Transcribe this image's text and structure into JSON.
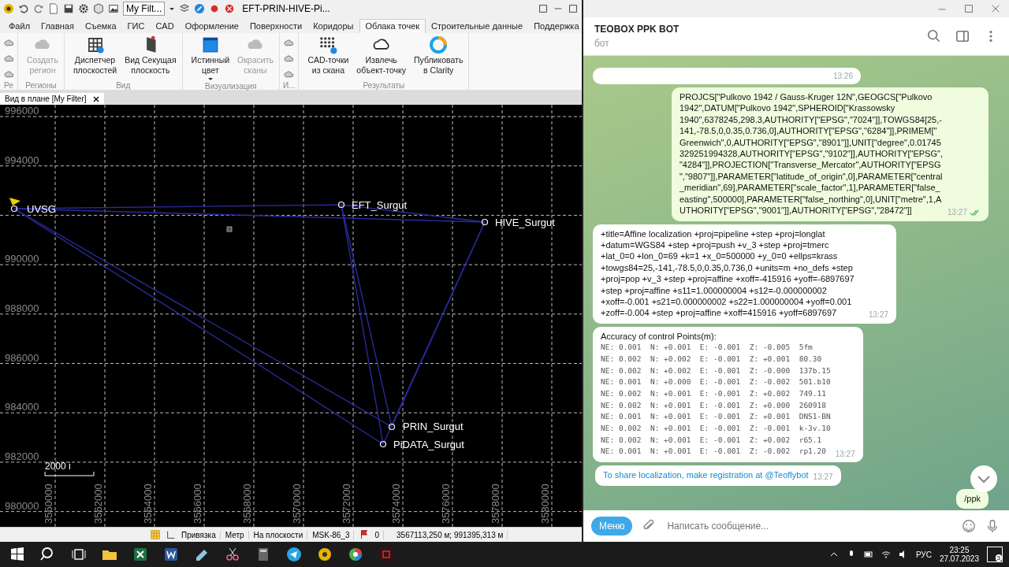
{
  "cad": {
    "filter": "My Filt...",
    "title": "EFT-PRIN-HIVE-Pi...",
    "ribbon_tabs": [
      {
        "label": "Файл",
        "selected": false
      },
      {
        "label": "Главная",
        "selected": false
      },
      {
        "label": "Съемка",
        "selected": false
      },
      {
        "label": "ГИС",
        "selected": false
      },
      {
        "label": "CAD",
        "selected": false
      },
      {
        "label": "Оформление",
        "selected": false
      },
      {
        "label": "Поверхности",
        "selected": false
      },
      {
        "label": "Коридоры",
        "selected": false
      },
      {
        "label": "Облака точек",
        "selected": true
      },
      {
        "label": "Строительные данные",
        "selected": false
      },
      {
        "label": "Поддержка",
        "selected": false
      }
    ],
    "ribbon_groups": [
      {
        "label": "Ре"
      },
      {
        "label": "Регионы",
        "buttons": [
          {
            "label": "Создать\nрегион",
            "disabled": true
          }
        ]
      },
      {
        "label": "Вид",
        "buttons": [
          {
            "label": "Диспетчер\nплоскостей",
            "disabled": false
          },
          {
            "label": "Вид Секущая\nплоскость",
            "disabled": false
          }
        ]
      },
      {
        "label": "Визуализация",
        "buttons": [
          {
            "label": "Истинный\nцвет",
            "disabled": false,
            "dropdown": true
          },
          {
            "label": "Окрасить\nсканы",
            "disabled": true
          }
        ]
      },
      {
        "label": "И..."
      },
      {
        "label": "Результаты",
        "buttons": [
          {
            "label": "CAD-точки\nиз скана",
            "disabled": false
          },
          {
            "label": "Извлечь\nобъект-точку",
            "disabled": false
          },
          {
            "label": "Публиковать\nв Clarity",
            "disabled": false
          }
        ]
      }
    ],
    "doc_tab": "Вид в плане [My Filter]",
    "plan": {
      "y_labels": [
        "996000",
        "994000",
        "990000",
        "988000",
        "986000",
        "984000",
        "982000",
        "980000"
      ],
      "x_labels": [
        "3560000",
        "3562000",
        "3564000",
        "3566000",
        "3568000",
        "3570000",
        "3572000",
        "3574000",
        "3576000",
        "3578000",
        "3580000"
      ],
      "points": [
        {
          "name": "UVSG"
        },
        {
          "name": "EFT_Surgut"
        },
        {
          "name": "HIVE_Surgut"
        },
        {
          "name": "PRIN_Surgut"
        },
        {
          "name": "PiDATA_Surgut"
        }
      ],
      "scale_label": "2000 i"
    },
    "status_bar": {
      "snap": "Привязка",
      "unit": "Метр",
      "plane": "На плоскости",
      "crs": "MSK-86_3",
      "count": "0",
      "coords": "3567113,250 м; 991395,313 м"
    }
  },
  "telegram": {
    "title": "TEOBOX PPK BOT",
    "subtitle": "бот",
    "messages": [
      {
        "kind": "partial",
        "outgoing": false,
        "time": "13:26"
      },
      {
        "kind": "text",
        "outgoing": true,
        "read": true,
        "time": "13:27",
        "text": "PROJCS[\"Pulkovo 1942 / Gauss-Kruger 12N\",GEOGCS[\"Pulkovo 1942\",DATUM[\"Pulkovo 1942\",SPHEROID[\"Krassowsky 1940\",6378245,298.3,AUTHORITY[\"EPSG\",\"7024\"]],TOWGS84[25,-141,-78.5,0,0.35,0.736,0],AUTHORITY[\"EPSG\",\"6284\"]],PRIMEM[\"Greenwich\",0,AUTHORITY[\"EPSG\",\"8901\"]],UNIT[\"degree\",0.01745329251994328,AUTHORITY[\"EPSG\",\"9102\"]],AUTHORITY[\"EPSG\",\"4284\"]],PROJECTION[\"Transverse_Mercator\",AUTHORITY[\"EPSG\",\"9807\"]],PARAMETER[\"latitude_of_origin\",0],PARAMETER[\"central_meridian\",69],PARAMETER[\"scale_factor\",1],PARAMETER[\"false_easting\",500000],PARAMETER[\"false_northing\",0],UNIT[\"metre\",1,AUTHORITY[\"EPSG\",\"9001\"]],AUTHORITY[\"EPSG\",\"28472\"]]"
      },
      {
        "kind": "text",
        "outgoing": false,
        "time": "13:27",
        "text": "+title=Affine localization +proj=pipeline +step +proj=longlat +datum=WGS84 +step +proj=push +v_3 +step +proj=tmerc +lat_0=0 +lon_0=69 +k=1 +x_0=500000 +y_0=0 +ellps=krass +towgs84=25,-141,-78.5,0,0.35,0.736,0 +units=m +no_defs +step +proj=pop +v_3 +step +proj=affine +xoff=-415916 +yoff=-6897697 +step +proj=affine +s11=1.000000004 +s12=-0.000000002 +xoff=-0.001 +s21=0.000000002 +s22=1.000000004 +yoff=0.001 +zoff=-0.004 +step +proj=affine +xoff=415916 +yoff=6897697"
      },
      {
        "kind": "table",
        "outgoing": false,
        "time": "13:27",
        "title": "Accuracy of control Points(m):",
        "rows": [
          "NE: 0.001  N: +0.001  E: -0.001  Z: -0.005  5fm",
          "NE: 0.002  N: +0.002  E: -0.001  Z: +0.001  80.30",
          "NE: 0.002  N: +0.002  E: -0.001  Z: -0.000  137b.15",
          "NE: 0.001  N: +0.000  E: -0.001  Z: -0.002  501.b10",
          "NE: 0.002  N: +0.001  E: -0.001  Z: +0.002  749.11",
          "NE: 0.002  N: +0.001  E: -0.001  Z: +0.000  260918",
          "NE: 0.001  N: +0.001  E: -0.001  Z: +0.001  DNS1-BN",
          "NE: 0.002  N: +0.001  E: -0.001  Z: -0.001  k-3v.10",
          "NE: 0.002  N: +0.001  E: -0.001  Z: +0.002  r65.1",
          "NE: 0.001  N: +0.001  E: -0.001  Z: -0.002  rp1.20"
        ]
      },
      {
        "kind": "link",
        "outgoing": false,
        "time": "13:27",
        "text": "To share localization, make registration at",
        "link": "@Teoflybot"
      },
      {
        "kind": "text",
        "outgoing": true,
        "text": "/ppk"
      }
    ],
    "menu_button": "Меню",
    "placeholder": "Написать сообщение..."
  },
  "taskbar": {
    "language": "РУС",
    "time": "23:25",
    "date": "27.07.2023",
    "notifications": "3"
  }
}
